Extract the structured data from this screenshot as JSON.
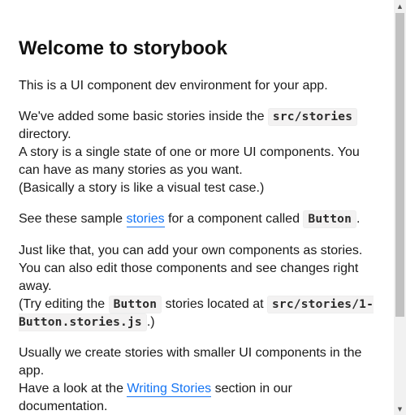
{
  "page": {
    "title": "Welcome to storybook",
    "intro": "This is a UI component dev environment for your app.",
    "para2": {
      "before_code": "We've added some basic stories inside the ",
      "code": "src/stories",
      "after_code": " directory.",
      "line2": "A story is a single state of one or more UI components. You can have as many stories as you want.",
      "line3": "(Basically a story is like a visual test case.)"
    },
    "para3": {
      "before_link": "See these sample ",
      "link": "stories",
      "middle": " for a component called ",
      "code": "Button",
      "after": "."
    },
    "para4": {
      "line1": "Just like that, you can add your own components as stories.",
      "line2": "You can also edit those components and see changes right away.",
      "line3_before": "(Try editing the ",
      "line3_code": "Button",
      "line3_middle": " stories located at ",
      "line3_code2": "src/stories/1-Button.stories.js",
      "line3_after": ".)"
    },
    "para5": {
      "line1": "Usually we create stories with smaller UI components in the app.",
      "line2_before": "Have a look at the ",
      "line2_link": "Writing Stories",
      "line2_after": " section in our documentation."
    }
  },
  "scrollbar": {
    "up_icon": "triangle-up",
    "down_icon": "triangle-down"
  },
  "colors": {
    "link": "#1474f3",
    "text": "#1a1a1a",
    "code_bg": "#f3f2f2"
  }
}
